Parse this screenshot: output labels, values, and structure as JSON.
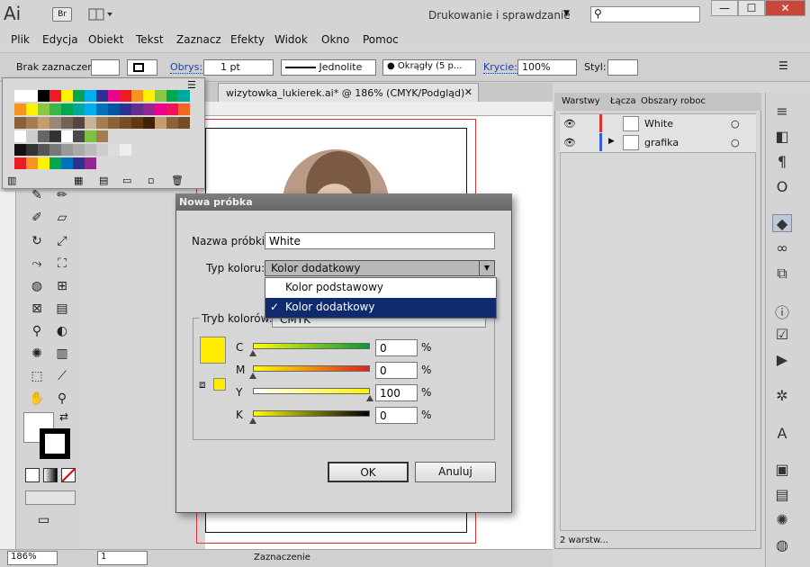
{
  "app": {
    "logo": "Ai",
    "bridge": "Br",
    "workspace": "Drukowanie i sprawdzanie"
  },
  "window": {
    "min": "—",
    "max": "☐",
    "close": "✕"
  },
  "menu": [
    "Plik",
    "Edycja",
    "Obiekt",
    "Tekst",
    "Zaznacz",
    "Efekty",
    "Widok",
    "Okno",
    "Pomoc"
  ],
  "control": {
    "selection": "Brak zaznaczenia",
    "stroke_label": "Obrys:",
    "stroke_value": "1 pt",
    "line_style": "Jednolite",
    "brush": "Okrągły (5 p...",
    "opacity_label": "Krycie:",
    "opacity_value": "100%",
    "style_label": "Styl:"
  },
  "document": {
    "tab": "wizytowka_lukierek.ai* @ 186% (CMYK/Podgląd)",
    "tab_close": "✕"
  },
  "status": {
    "zoom": "186%",
    "page": "1",
    "tool": "Zaznaczenie"
  },
  "layers": {
    "tabs": [
      "Warstwy",
      "Łącza",
      "Obszary roboc"
    ],
    "rows": [
      {
        "name": "White",
        "color": "#e03030"
      },
      {
        "name": "grafika",
        "color": "#3060e0"
      }
    ],
    "footer": "2 warstw..."
  },
  "dialog": {
    "title": "Nowa próbka",
    "name_label": "Nazwa próbki:",
    "name_value": "White",
    "type_label": "Typ koloru:",
    "type_value": "Kolor dodatkowy",
    "dropdown": [
      "Kolor podstawowy",
      "Kolor dodatkowy"
    ],
    "check": "✓",
    "mode_label": "Tryb kolorów:",
    "mode_value": "CMYK",
    "channels": [
      {
        "label": "C",
        "value": "0",
        "unit": "%",
        "level": 0
      },
      {
        "label": "M",
        "value": "0",
        "unit": "%",
        "level": 0
      },
      {
        "label": "Y",
        "value": "100",
        "unit": "%",
        "level": 100
      },
      {
        "label": "K",
        "value": "0",
        "unit": "%",
        "level": 0
      }
    ],
    "ok": "OK",
    "cancel": "Anuluj",
    "swatch_color": "#ffec00"
  }
}
